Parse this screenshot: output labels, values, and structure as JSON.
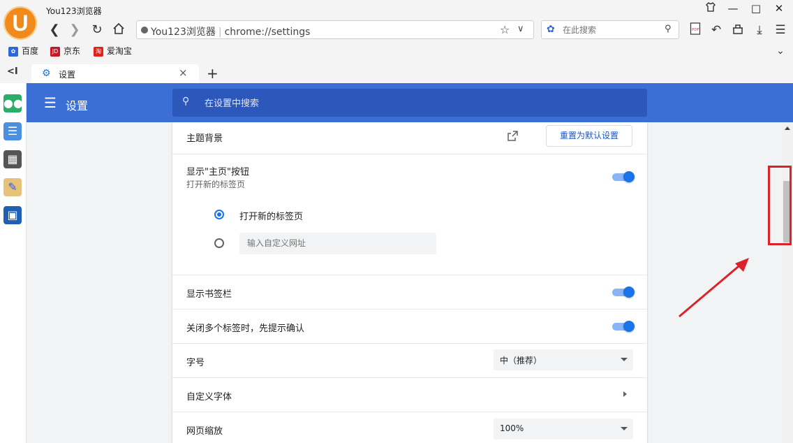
{
  "window": {
    "app_title": "You123浏览器",
    "logo_letter": "U",
    "controls": [
      "shirt-icon",
      "minimize-icon",
      "maximize-icon",
      "close-icon"
    ]
  },
  "toolbar": {
    "address_site": "You123浏览器",
    "address_url": "chrome://settings",
    "search_placeholder": "在此搜索"
  },
  "bookmarks": [
    {
      "label": "百度",
      "color": "#2f67d8"
    },
    {
      "label": "京东",
      "color": "#c81623"
    },
    {
      "label": "爱淘宝",
      "color": "#e2231a"
    }
  ],
  "tab": {
    "label": "设置"
  },
  "settings": {
    "title": "设置",
    "search_placeholder": "在设置中搜索",
    "theme": {
      "label": "主题背景",
      "reset_button": "重置为默认设置"
    },
    "home_button": {
      "label": "显示\"主页\"按钮",
      "sub": "打开新的标签页",
      "enabled": true
    },
    "home_options": {
      "option_newtab": "打开新的标签页",
      "custom_placeholder": "输入自定义网址",
      "selected": "newtab"
    },
    "bookmarks_bar": {
      "label": "显示书签栏",
      "enabled": true
    },
    "close_confirm": {
      "label": "关闭多个标签时，先提示确认",
      "enabled": true
    },
    "font_size": {
      "label": "字号",
      "value": "中（推荐）"
    },
    "custom_fonts": {
      "label": "自定义字体"
    },
    "zoom": {
      "label": "网页缩放",
      "value": "100%"
    }
  },
  "colors": {
    "header": "#3b6fd6",
    "accent": "#1a73e8",
    "annotation": "#d9222a"
  }
}
